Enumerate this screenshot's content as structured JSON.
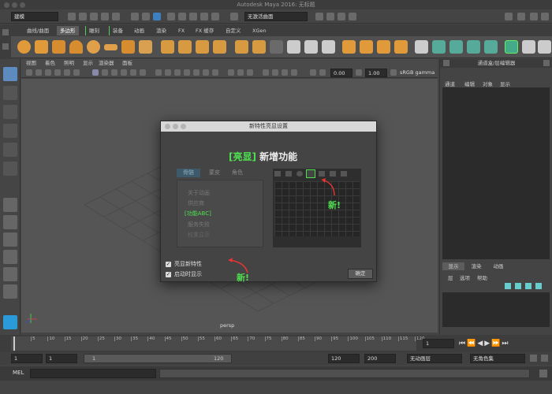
{
  "window": {
    "title": "Autodesk Maya 2016: 无标题"
  },
  "status_line": {
    "mode_select": "建模",
    "no_live_surface": "无激活曲面"
  },
  "shelf_tabs": [
    "曲线/曲面",
    "多边形",
    "雕刻",
    "装备",
    "动画",
    "渲染",
    "FX",
    "FX 缓存",
    "自定义",
    "XGen"
  ],
  "active_shelf_tab": "多边形",
  "viewport_menu": [
    "视图",
    "着色",
    "照明",
    "显示",
    "渲染器",
    "面板"
  ],
  "viewport_toolbar": {
    "value1": "0.00",
    "value2": "1.00",
    "color_space": "sRGB gamma"
  },
  "viewport": {
    "camera_label": "persp"
  },
  "channel_box": {
    "title": "通道盒/层编辑器",
    "menu": [
      "通道",
      "编辑",
      "对象",
      "显示"
    ]
  },
  "layer_editor": {
    "tabs": [
      "显示",
      "渲染",
      "动画"
    ],
    "menu": [
      "层",
      "选项",
      "帮助"
    ]
  },
  "dialog": {
    "title": "新特性亮显设置",
    "heading_bracket": "[亮显]",
    "heading_text": "新增功能",
    "tabs": [
      "骨骼",
      "蒙皮",
      "角色"
    ],
    "menu_items": [
      "关于动画",
      "供应商",
      "功能ABC",
      "服务失败",
      "权重显示"
    ],
    "new_label": "新!",
    "checkbox_highlight": "亮显新特性",
    "checkbox_startup": "启动时显示",
    "ok_button": "确定"
  },
  "timeline": {
    "ticks": [
      "5",
      "10",
      "15",
      "20",
      "25",
      "30",
      "35",
      "40",
      "45",
      "50",
      "55",
      "60",
      "65",
      "70",
      "75",
      "80",
      "85",
      "90",
      "95",
      "100",
      "105",
      "110",
      "115",
      "120"
    ],
    "current_frame": "1"
  },
  "range_slider": {
    "start": "1",
    "playback_start": "1",
    "slider_start": "1",
    "slider_end": "120",
    "playback_end": "120",
    "end": "200",
    "anim_layer": "无动画层",
    "character_set": "无角色集"
  },
  "command_line": {
    "label": "MEL"
  }
}
